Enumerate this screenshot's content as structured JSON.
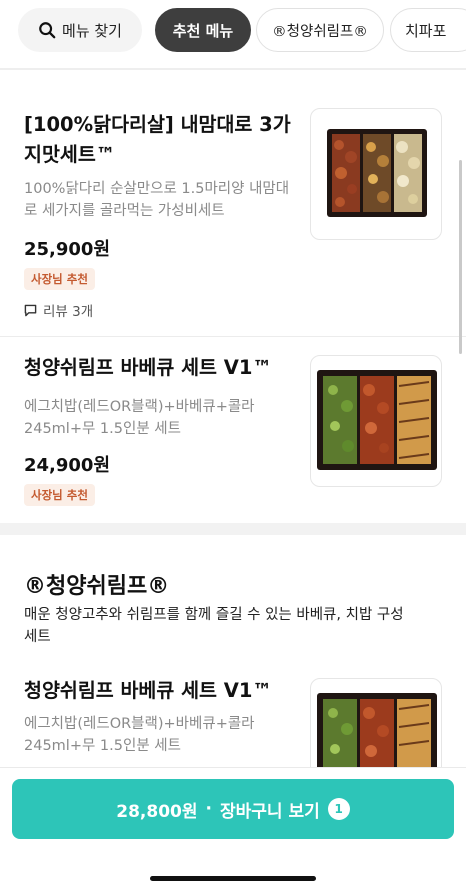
{
  "chips": {
    "search_label": "메뉴 찾기",
    "recommended_label": "추천 메뉴",
    "shrimp_label": "®청양쉬림프®",
    "chipapo_label": "치파포"
  },
  "items": [
    {
      "name_line1": "[100%닭다리살] 내맘대로 3가",
      "name_line2": "지맛세트™",
      "desc_line1": "100%닭다리 순살만으로 1.5마리양 내맘대",
      "desc_line2": "로 세가지를 골라먹는 가성비세트",
      "price": "25,900원",
      "badge": "사장님 추천",
      "review": "리뷰 3개"
    },
    {
      "name": "청양쉬림프 바베큐 세트 V1™",
      "desc_line1": "에그치밥(레드OR블랙)+바베큐+콜라",
      "desc_line2": "245ml+무 1.5인분 세트",
      "price": "24,900원",
      "badge": "사장님 추천"
    }
  ],
  "section": {
    "title": "®청양쉬림프®",
    "desc_line1": "매운 청양고추와 쉬림프를 함께 즐길 수 있는 바베큐, 치밥  구성",
    "desc_line2": "세트",
    "item": {
      "name": "청양쉬림프 바베큐 세트 V1™",
      "desc_line1": "에그치밥(레드OR블랙)+바베큐+콜라",
      "desc_line2": "245ml+무 1.5인분 세트"
    }
  },
  "cart": {
    "price": "28,800원",
    "separator": "·",
    "label": "장바구니 보기",
    "count": "1"
  },
  "colors": {
    "accent": "#2dc5b8",
    "badge_bg": "#fbeee6",
    "badge_text": "#c45a30",
    "active_chip": "#3e3e3e"
  }
}
